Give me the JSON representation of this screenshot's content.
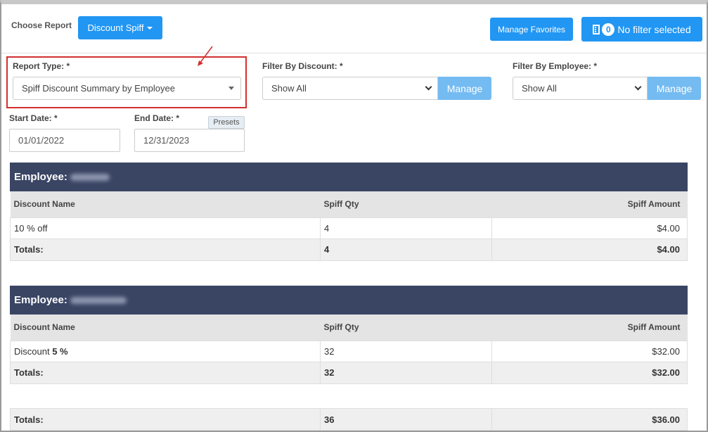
{
  "toolbar": {
    "choose_report_label": "Choose Report",
    "report_button_label": "Discount Spiff",
    "manage_favorites_label": "Manage Favorites",
    "filter_count": "0",
    "filter_label": "No filter selected"
  },
  "filters": {
    "report_type_label": "Report Type: *",
    "report_type_value": "Spiff Discount Summary by Employee",
    "discount_label": "Filter By Discount: *",
    "discount_value": "Show All",
    "employee_label": "Filter By Employee: *",
    "employee_value": "Show All",
    "manage_label": "Manage",
    "start_date_label": "Start Date: *",
    "start_date_value": "01/01/2022",
    "end_date_label": "End Date: *",
    "end_date_value": "12/31/2023",
    "presets_label": "Presets"
  },
  "report": {
    "employee_prefix": "Employee:",
    "columns": [
      "Discount Name",
      "Spiff Qty",
      "Spiff Amount"
    ],
    "totals_label": "Totals:",
    "groups": [
      {
        "rows": [
          {
            "name": "10 % off",
            "qty": "4",
            "amount": "$4.00"
          }
        ],
        "total_qty": "4",
        "total_amount": "$4.00"
      },
      {
        "rows": [
          {
            "name": "Discount",
            "name_suffix": "5 %",
            "qty": "32",
            "amount": "$32.00"
          }
        ],
        "total_qty": "32",
        "total_amount": "$32.00"
      }
    ],
    "grand_total_qty": "36",
    "grand_total_amount": "$36.00"
  },
  "colors": {
    "primary_button": "#2196f3",
    "manage_button": "#74bbf2",
    "employee_header": "#3a4564",
    "highlight_box": "#d32f2f"
  }
}
